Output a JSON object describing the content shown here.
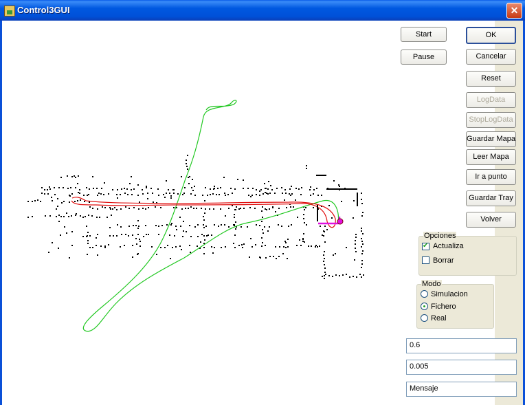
{
  "window": {
    "title": "Control3GUI",
    "close_glyph": "✕"
  },
  "buttons": {
    "start": "Start",
    "pause": "Pause",
    "ok": "OK",
    "cancelar": "Cancelar",
    "reset": "Reset",
    "logdata": "LogData",
    "stoplogdata": "StopLogData",
    "guardar_mapa": "Guardar Mapa",
    "leer_mapa": "Leer Mapa",
    "ir_a_punto": "Ir a punto",
    "guardar_tray": "Guardar Tray",
    "volver": "Volver"
  },
  "opciones": {
    "title": "Opciones",
    "items": [
      {
        "label": "Actualiza",
        "checked": true
      },
      {
        "label": "Borrar",
        "checked": false
      }
    ]
  },
  "modo": {
    "title": "Modo",
    "items": [
      {
        "label": "Simulacion",
        "selected": false
      },
      {
        "label": "Fichero",
        "selected": true
      },
      {
        "label": "Real",
        "selected": false
      }
    ]
  },
  "fields": {
    "value1": "0.6",
    "value2": "0.005",
    "mensaje": "Mensaje"
  },
  "colors": {
    "map_points": "#000000",
    "green_trajectory": "#22c822",
    "red_trajectory": "#e01010",
    "magenta_path": "#e010e0"
  }
}
